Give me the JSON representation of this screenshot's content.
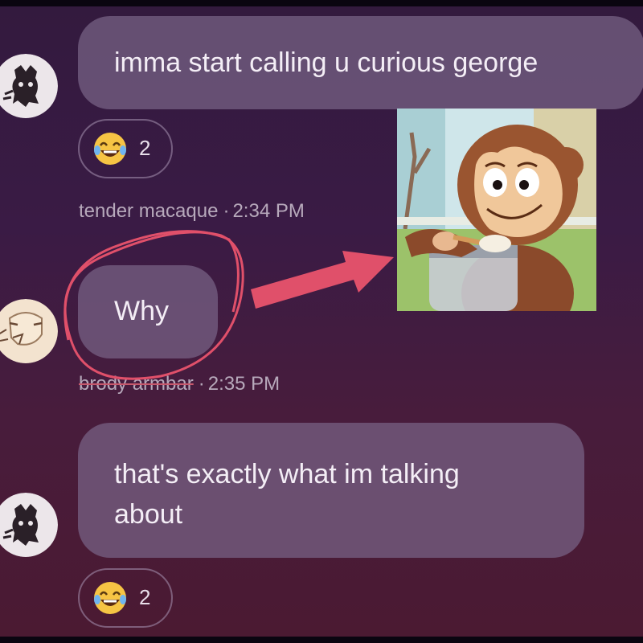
{
  "messages": [
    {
      "text": "imma start calling u curious george",
      "reaction": {
        "emoji": "face-with-tears-of-joy",
        "count": "2"
      },
      "author": "tender macaque",
      "time": "2:34 PM"
    },
    {
      "text": "Why",
      "author": "brody armbar",
      "time": "2:35 PM"
    },
    {
      "text_line1": "that's exactly what im talking",
      "text_line2": "about",
      "reaction": {
        "emoji": "face-with-tears-of-joy",
        "count": "2"
      }
    }
  ],
  "separator": "·",
  "colors": {
    "background_top": "#331a3e",
    "background_bottom": "#4b1a32",
    "bubble": "#786487",
    "annotation": "#e0506a",
    "meta_text": "#b7a9bb"
  }
}
